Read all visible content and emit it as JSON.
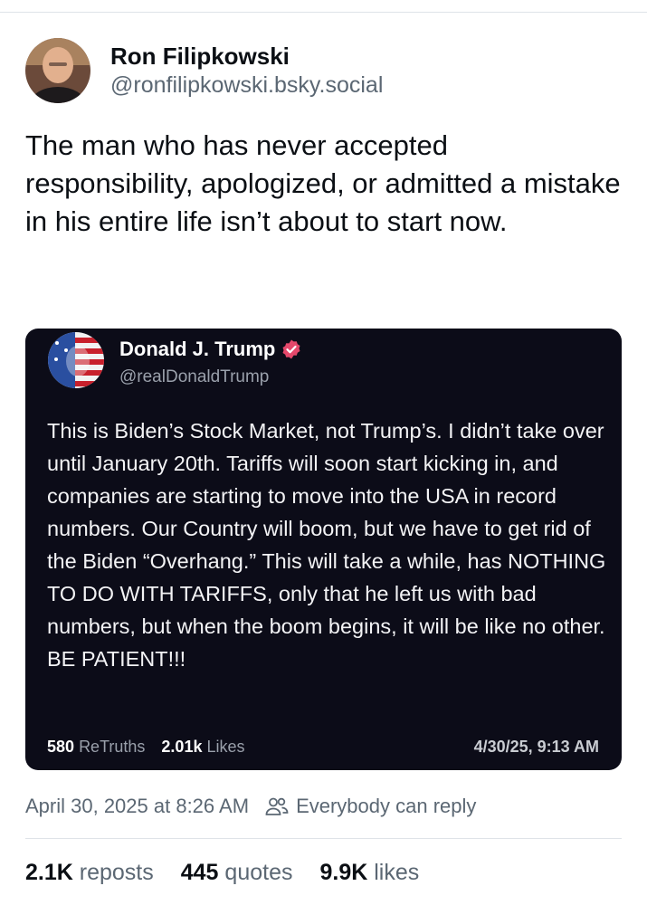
{
  "post": {
    "author": {
      "display_name": "Ron Filipkowski",
      "handle": "@ronfilipkowski.bsky.social"
    },
    "text": "The man who has never accepted responsibility, apologized, or admitted a mistake in his entire life isn’t about to start now.",
    "timestamp": "April 30, 2025 at 8:26 AM",
    "reply_setting": "Everybody can reply",
    "counts": {
      "reposts_value": "2.1K",
      "reposts_label": "reposts",
      "quotes_value": "445",
      "quotes_label": "quotes",
      "likes_value": "9.9K",
      "likes_label": "likes"
    }
  },
  "embed": {
    "display_name": "Donald J. Trump",
    "handle": "@realDonaldTrump",
    "verified": true,
    "text": "This is Biden’s Stock Market, not Trump’s. I didn’t take over until January 20th. Tariffs will soon start kicking in, and companies are starting to move into the USA in record numbers. Our Country will boom, but we have to get rid of the Biden “Overhang.” This will take a while, has NOTHING TO DO WITH TARIFFS, only that he left us with bad numbers, but when the boom begins, it will be like no other. BE PATIENT!!!",
    "retruths_value": "580",
    "retruths_label": "ReTruths",
    "likes_value": "2.01k",
    "likes_label": "Likes",
    "date": "4/30/25, 9:13 AM"
  },
  "colors": {
    "embed_background": "#0c0c18",
    "verified_badge": "#e5486b",
    "muted_text": "#5b6773"
  }
}
